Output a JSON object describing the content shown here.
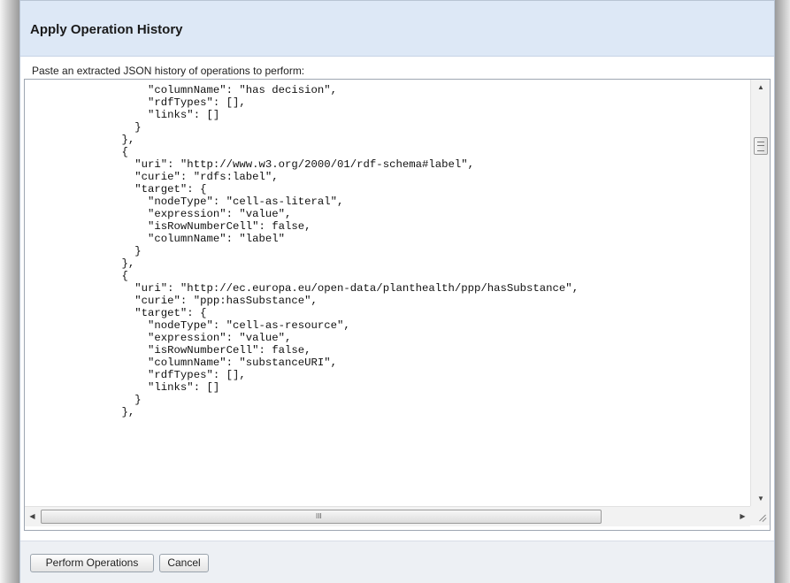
{
  "dialog": {
    "title": "Apply Operation History",
    "prompt": "Paste an extracted JSON history of operations to perform:"
  },
  "textarea": {
    "lines": [
      "        \"columnName\": \"has decision\",",
      "        \"rdfTypes\": [],",
      "        \"links\": []",
      "      }",
      "    },",
      "    {",
      "      \"uri\": \"http://www.w3.org/2000/01/rdf-schema#label\",",
      "      \"curie\": \"rdfs:label\",",
      "      \"target\": {",
      "        \"nodeType\": \"cell-as-literal\",",
      "        \"expression\": \"value\",",
      "        \"isRowNumberCell\": false,",
      "        \"columnName\": \"label\"",
      "      }",
      "    },",
      "    {",
      "      \"uri\": \"http://ec.europa.eu/open-data/planthealth/ppp/hasSubstance\",",
      "      \"curie\": \"ppp:hasSubstance\",",
      "      \"target\": {",
      "        \"nodeType\": \"cell-as-resource\",",
      "        \"expression\": \"value\",",
      "        \"isRowNumberCell\": false,",
      "        \"columnName\": \"substanceURI\",",
      "        \"rdfTypes\": [],",
      "        \"links\": []",
      "      }",
      "    },"
    ],
    "hscroll_grip": "III"
  },
  "footer": {
    "perform_label": "Perform Operations",
    "cancel_label": "Cancel"
  }
}
